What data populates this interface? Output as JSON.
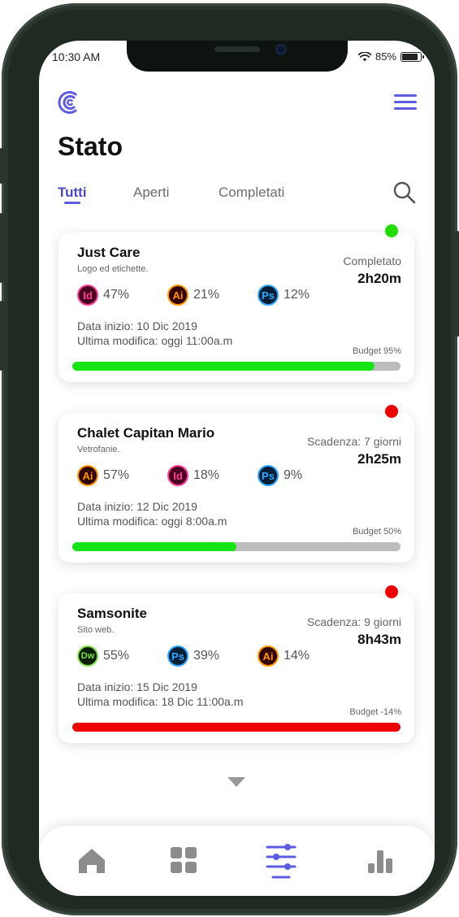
{
  "colors": {
    "accent": "#5c5ce0",
    "complete_dot": "#22dd00",
    "overdue_dot": "#ee0000",
    "bar_green": "#15e415",
    "bar_red": "#ee0000",
    "bar_track": "#bdbdbd"
  },
  "status_bar": {
    "time": "10:30 AM",
    "battery": "85%",
    "battery_level": 0.85,
    "wifi_icon": "wifi-icon"
  },
  "header": {
    "title": "Stato",
    "logo_icon": "logo-icon",
    "menu_icon": "hamburger-menu-icon"
  },
  "tabs": [
    {
      "label": "Tutti",
      "active": true
    },
    {
      "label": "Aperti",
      "active": false
    },
    {
      "label": "Completati",
      "active": false
    }
  ],
  "search_icon": "search-icon",
  "projects": [
    {
      "title": "Just Care",
      "subtitle": "Logo ed etichette.",
      "state": "Completato",
      "time": "2h20m",
      "status_color": "green",
      "apps": [
        {
          "code": "Id",
          "pct": "47%"
        },
        {
          "code": "Ai",
          "pct": "21%"
        },
        {
          "code": "Ps",
          "pct": "12%"
        }
      ],
      "start": "Data inizio: 10 Dic 2019",
      "modified": "Ultima modifica: oggi 11:00a.m",
      "budget_label": "Budget 95%",
      "budget_fraction": 0.92,
      "bar_color": "green"
    },
    {
      "title": "Chalet Capitan Mario",
      "subtitle": "Vetrofanie.",
      "state": "Scadenza: 7 giorni",
      "time": "2h25m",
      "status_color": "red",
      "apps": [
        {
          "code": "Ai",
          "pct": "57%"
        },
        {
          "code": "Id",
          "pct": "18%"
        },
        {
          "code": "Ps",
          "pct": "9%"
        }
      ],
      "start": "Data inizio: 12 Dic 2019",
      "modified": "Ultima modifica: oggi 8:00a.m",
      "budget_label": "Budget 50%",
      "budget_fraction": 0.5,
      "bar_color": "green"
    },
    {
      "title": "Samsonite",
      "subtitle": "Sito web.",
      "state": "Scadenza: 9 giorni",
      "time": "8h43m",
      "status_color": "red",
      "apps": [
        {
          "code": "Dw",
          "pct": "55%"
        },
        {
          "code": "Ps",
          "pct": "39%"
        },
        {
          "code": "Ai",
          "pct": "14%"
        }
      ],
      "start": "Data inizio: 15 Dic 2019",
      "modified": "Ultima modifica: 18 Dic 11:00a.m",
      "budget_label": "Budget -14%",
      "budget_fraction": 1.0,
      "bar_color": "red"
    }
  ],
  "bottom_nav": [
    {
      "icon": "home-icon",
      "active": false
    },
    {
      "icon": "grid-icon",
      "active": false
    },
    {
      "icon": "sliders-icon",
      "active": true
    },
    {
      "icon": "bar-chart-icon",
      "active": false
    }
  ]
}
